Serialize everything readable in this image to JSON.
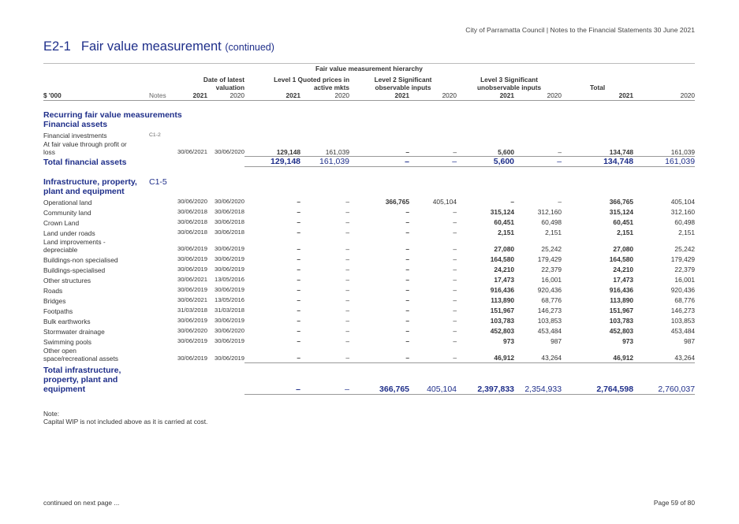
{
  "header": "City of Parramatta Council | Notes to the Financial Statements 30 June 2021",
  "title": {
    "code": "E2-1",
    "main": "Fair value measurement",
    "sub": "(continued)"
  },
  "hierarchy_label": "Fair value measurement hierarchy",
  "columns": {
    "unit": "$ '000",
    "notes": "Notes",
    "date_h1": "Date of latest",
    "date_h2": "valuation",
    "l1_h1": "Level 1 Quoted prices in",
    "l1_h2": "active mkts",
    "l2_h1": "Level 2 Significant",
    "l2_h2": "observable inputs",
    "l3_h1": "Level 3 Significant",
    "l3_h2": "unobservable inputs",
    "total_h": "Total",
    "y2021": "2021",
    "y2020": "2020"
  },
  "sections": {
    "recurring": "Recurring fair value measurements",
    "fin_assets": "Financial assets",
    "infra_l1": "Infrastructure, property,",
    "infra_l2": "plant and equipment",
    "infra_note": "C1-5"
  },
  "financial": {
    "inv_label": "Financial investments",
    "inv_note": "C1-2",
    "fvtpl_l1": "At fair value through profit or",
    "fvtpl_l2": "loss",
    "fvtpl": {
      "d21": "30/06/2021",
      "d20": "30/06/2020",
      "l1_21": "129,148",
      "l1_20": "161,039",
      "l2_21": "–",
      "l2_20": "–",
      "l3_21": "5,600",
      "l3_20": "–",
      "t21": "134,748",
      "t20": "161,039"
    },
    "total_label": "Total financial assets",
    "total": {
      "l1_21": "129,148",
      "l1_20": "161,039",
      "l2_21": "–",
      "l2_20": "–",
      "l3_21": "5,600",
      "l3_20": "–",
      "t21": "134,748",
      "t20": "161,039"
    }
  },
  "infra_rows": [
    {
      "label": "Operational land",
      "d21": "30/06/2020",
      "d20": "30/06/2020",
      "l1_21": "–",
      "l1_20": "–",
      "l2_21": "366,765",
      "l2_20": "405,104",
      "l3_21": "–",
      "l3_20": "–",
      "t21": "366,765",
      "t20": "405,104"
    },
    {
      "label": "Community land",
      "d21": "30/06/2018",
      "d20": "30/06/2018",
      "l1_21": "–",
      "l1_20": "–",
      "l2_21": "–",
      "l2_20": "–",
      "l3_21": "315,124",
      "l3_20": "312,160",
      "t21": "315,124",
      "t20": "312,160"
    },
    {
      "label": "Crown Land",
      "d21": "30/06/2018",
      "d20": "30/06/2018",
      "l1_21": "–",
      "l1_20": "–",
      "l2_21": "–",
      "l2_20": "–",
      "l3_21": "60,451",
      "l3_20": "60,498",
      "t21": "60,451",
      "t20": "60,498"
    },
    {
      "label": "Land under roads",
      "d21": "30/06/2018",
      "d20": "30/06/2018",
      "l1_21": "–",
      "l1_20": "–",
      "l2_21": "–",
      "l2_20": "–",
      "l3_21": "2,151",
      "l3_20": "2,151",
      "t21": "2,151",
      "t20": "2,151"
    },
    {
      "label": "Land improvements - depreciable",
      "d21": "30/06/2019",
      "d20": "30/06/2019",
      "l1_21": "–",
      "l1_20": "–",
      "l2_21": "–",
      "l2_20": "–",
      "l3_21": "27,080",
      "l3_20": "25,242",
      "t21": "27,080",
      "t20": "25,242"
    },
    {
      "label": "Buildings-non specialised",
      "d21": "30/06/2019",
      "d20": "30/06/2019",
      "l1_21": "–",
      "l1_20": "–",
      "l2_21": "–",
      "l2_20": "–",
      "l3_21": "164,580",
      "l3_20": "179,429",
      "t21": "164,580",
      "t20": "179,429"
    },
    {
      "label": "Buildings-specialised",
      "d21": "30/06/2019",
      "d20": "30/06/2019",
      "l1_21": "–",
      "l1_20": "–",
      "l2_21": "–",
      "l2_20": "–",
      "l3_21": "24,210",
      "l3_20": "22,379",
      "t21": "24,210",
      "t20": "22,379"
    },
    {
      "label": "Other structures",
      "d21": "30/06/2021",
      "d20": "13/05/2016",
      "l1_21": "–",
      "l1_20": "–",
      "l2_21": "–",
      "l2_20": "–",
      "l3_21": "17,473",
      "l3_20": "16,001",
      "t21": "17,473",
      "t20": "16,001"
    },
    {
      "label": "Roads",
      "d21": "30/06/2019",
      "d20": "30/06/2019",
      "l1_21": "–",
      "l1_20": "–",
      "l2_21": "–",
      "l2_20": "–",
      "l3_21": "916,436",
      "l3_20": "920,436",
      "t21": "916,436",
      "t20": "920,436"
    },
    {
      "label": "Bridges",
      "d21": "30/06/2021",
      "d20": "13/05/2016",
      "l1_21": "–",
      "l1_20": "–",
      "l2_21": "–",
      "l2_20": "–",
      "l3_21": "113,890",
      "l3_20": "68,776",
      "t21": "113,890",
      "t20": "68,776"
    },
    {
      "label": "Footpaths",
      "d21": "31/03/2018",
      "d20": "31/03/2018",
      "l1_21": "–",
      "l1_20": "–",
      "l2_21": "–",
      "l2_20": "–",
      "l3_21": "151,967",
      "l3_20": "146,273",
      "t21": "151,967",
      "t20": "146,273"
    },
    {
      "label": "Bulk earthworks",
      "d21": "30/06/2019",
      "d20": "30/06/2019",
      "l1_21": "–",
      "l1_20": "–",
      "l2_21": "–",
      "l2_20": "–",
      "l3_21": "103,783",
      "l3_20": "103,853",
      "t21": "103,783",
      "t20": "103,853"
    },
    {
      "label": "Stormwater drainage",
      "d21": "30/06/2020",
      "d20": "30/06/2020",
      "l1_21": "–",
      "l1_20": "–",
      "l2_21": "–",
      "l2_20": "–",
      "l3_21": "452,803",
      "l3_20": "453,484",
      "t21": "452,803",
      "t20": "453,484"
    },
    {
      "label": "Swimming pools",
      "d21": "30/06/2019",
      "d20": "30/06/2019",
      "l1_21": "–",
      "l1_20": "–",
      "l2_21": "–",
      "l2_20": "–",
      "l3_21": "973",
      "l3_20": "987",
      "t21": "973",
      "t20": "987"
    },
    {
      "label": "Other open space/recreational assets",
      "d21": "30/06/2019",
      "d20": "30/06/2019",
      "l1_21": "–",
      "l1_20": "–",
      "l2_21": "–",
      "l2_20": "–",
      "l3_21": "46,912",
      "l3_20": "43,264",
      "t21": "46,912",
      "t20": "43,264"
    }
  ],
  "infra_total": {
    "label": "Total infrastructure, property, plant and equipment",
    "l1_21": "–",
    "l1_20": "–",
    "l2_21": "366,765",
    "l2_20": "405,104",
    "l3_21": "2,397,833",
    "l3_20": "2,354,933",
    "t21": "2,764,598",
    "t20": "2,760,037"
  },
  "note": {
    "title": "Note:",
    "text": "Capital WIP is not included above as it is carried at cost."
  },
  "footer": {
    "left": "continued on next page ...",
    "right": "Page 59 of 80"
  }
}
